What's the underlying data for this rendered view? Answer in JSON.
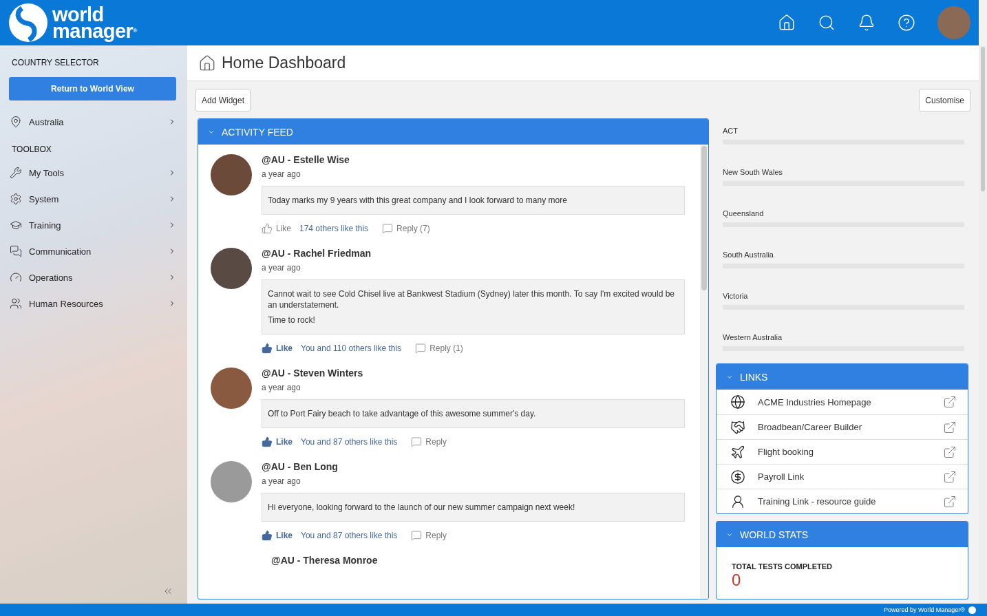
{
  "header": {
    "logo": {
      "line1": "world",
      "line2": "manager$^{®}$"
    }
  },
  "sidebar": {
    "country_heading": "COUNTRY SELECTOR",
    "return_button": "Return to World View",
    "country": {
      "label": "Australia"
    },
    "toolbox_heading": "TOOLBOX",
    "items": [
      {
        "label": "My Tools"
      },
      {
        "label": "System"
      },
      {
        "label": "Training"
      },
      {
        "label": "Communication"
      },
      {
        "label": "Operations"
      },
      {
        "label": "Human Resources"
      }
    ]
  },
  "page": {
    "title": "Home Dashboard",
    "add_widget": "Add Widget",
    "customise": "Customise"
  },
  "activity_feed": {
    "title": "ACTIVITY FEED",
    "posts": [
      {
        "author": "@AU - Estelle Wise",
        "time": "a year ago",
        "paragraphs": [
          "Today marks my 9 years with this great company and I look forward to many more"
        ],
        "like": "Like",
        "liked": false,
        "likes_text": "174 others like this",
        "reply": "Reply (7)"
      },
      {
        "author": "@AU - Rachel Friedman",
        "time": "a year ago",
        "paragraphs": [
          "Cannot wait to see Cold Chisel live at Bankwest Stadium (Sydney) later this month. To say I'm excited would be an understatement.",
          "Time to rock!"
        ],
        "like": "Like",
        "liked": true,
        "likes_text": "You and 110 others like this",
        "reply": "Reply (1)"
      },
      {
        "author": "@AU - Steven Winters",
        "time": "a year ago",
        "paragraphs": [
          "Off to Port Fairy beach to take advantage of this awesome summer's day."
        ],
        "like": "Like",
        "liked": true,
        "likes_text": "You and 87 others like this",
        "reply": "Reply"
      },
      {
        "author": "@AU - Ben Long",
        "time": "a year ago",
        "paragraphs": [
          "Hi everyone, looking forward to the launch of our new summer campaign next week!"
        ],
        "like": "Like",
        "liked": true,
        "likes_text": "You and 87 others like this",
        "reply": "Reply"
      }
    ],
    "partial_author": "@AU - Theresa Monroe"
  },
  "regions": [
    {
      "name": "ACT"
    },
    {
      "name": "New South Wales"
    },
    {
      "name": "Queensland"
    },
    {
      "name": "South Australia"
    },
    {
      "name": "Victoria"
    },
    {
      "name": "Western Australia"
    }
  ],
  "links": {
    "title": "LINKS",
    "items": [
      {
        "label": "ACME Industries Homepage"
      },
      {
        "label": "Broadbean/Career Builder"
      },
      {
        "label": "Flight booking"
      },
      {
        "label": "Payroll Link"
      },
      {
        "label": "Training Link - resource guide"
      }
    ]
  },
  "world_stats": {
    "title": "WORLD STATS",
    "stat_label": "TOTAL TESTS COMPLETED",
    "stat_value": "0"
  },
  "footer": {
    "text": "Powered by World Manager®"
  }
}
